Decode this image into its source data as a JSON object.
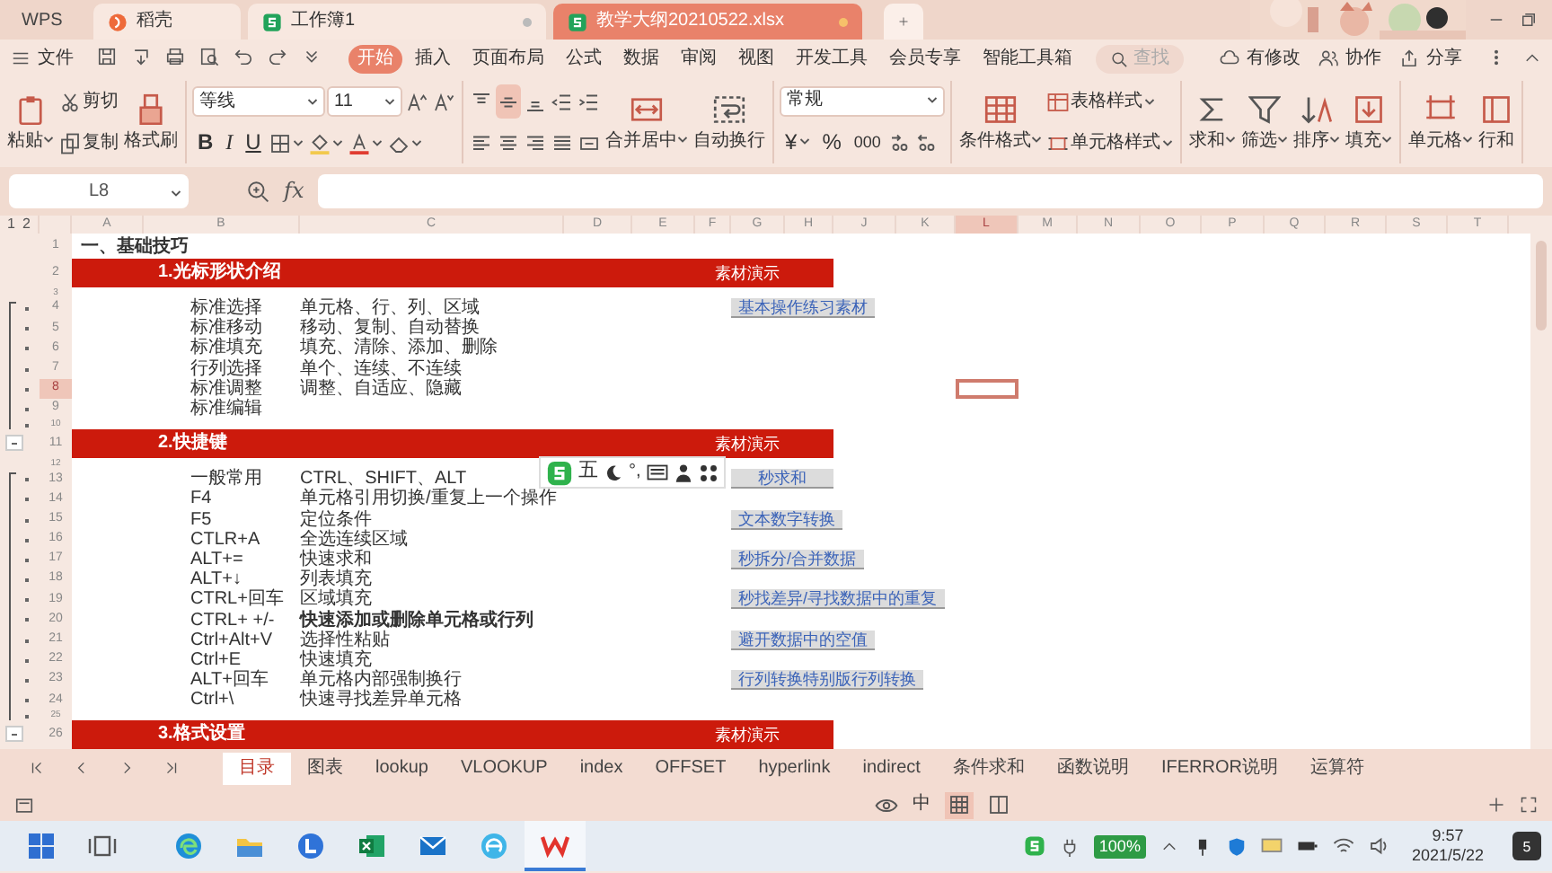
{
  "title_tabs": [
    {
      "label": "WPS",
      "kind": "home",
      "selected": false
    },
    {
      "label": "稻壳",
      "kind": "docer",
      "selected": false
    },
    {
      "label": "工作簿1",
      "kind": "sheet",
      "selected": false
    },
    {
      "label": "教学大纲20210522.xlsx",
      "kind": "sheet",
      "selected": true
    }
  ],
  "menu": {
    "file": "文件",
    "tabs": [
      {
        "label": "开始",
        "selected": true
      },
      {
        "label": "插入",
        "selected": false
      },
      {
        "label": "页面布局",
        "selected": false
      },
      {
        "label": "公式",
        "selected": false
      },
      {
        "label": "数据",
        "selected": false
      },
      {
        "label": "审阅",
        "selected": false
      },
      {
        "label": "视图",
        "selected": false
      },
      {
        "label": "开发工具",
        "selected": false
      },
      {
        "label": "会员专享",
        "selected": false
      },
      {
        "label": "智能工具箱",
        "selected": false
      }
    ],
    "search": {
      "placeholder": "查找"
    },
    "actions": [
      {
        "label": "有修改",
        "kind": "cloud"
      },
      {
        "label": "协作",
        "kind": "people"
      },
      {
        "label": "分享",
        "kind": "share"
      }
    ]
  },
  "ribbon": [
    {
      "controls": [
        {
          "kind": "paste",
          "label": "粘贴",
          "dropdown": true
        },
        {
          "kind": "stack",
          "lines": [
            [
              {
                "kind": "cut",
                "label": "剪切"
              }
            ],
            [
              {
                "kind": "copy",
                "label": "复制"
              }
            ]
          ]
        },
        {
          "kind": "brush",
          "label": "格式刷"
        }
      ]
    },
    {
      "controls": [
        {
          "kind": "stack",
          "lines": [
            [
              {
                "kind": "font",
                "value": "等线"
              },
              {
                "kind": "size",
                "value": "11"
              },
              {
                "kind": "grow"
              },
              {
                "kind": "shrink"
              }
            ],
            [
              {
                "kind": "bold",
                "label": "B"
              },
              {
                "kind": "italic",
                "label": "I"
              },
              {
                "kind": "underline",
                "label": "U"
              },
              {
                "kind": "border",
                "dropdown": true
              },
              {
                "kind": "fill",
                "dropdown": true
              },
              {
                "kind": "fontcolor",
                "dropdown": true
              },
              {
                "kind": "eraser",
                "dropdown": true
              }
            ]
          ]
        }
      ]
    },
    {
      "controls": [
        {
          "kind": "stack",
          "lines": [
            [
              {
                "kind": "vtop",
                "selected": false
              },
              {
                "kind": "vmid",
                "selected": true
              },
              {
                "kind": "vbot",
                "selected": false
              },
              {
                "kind": "indl",
                "selected": false
              },
              {
                "kind": "indr",
                "selected": false
              }
            ],
            [
              {
                "kind": "left",
                "selected": false
              },
              {
                "kind": "center",
                "selected": false
              },
              {
                "kind": "right",
                "selected": false
              },
              {
                "kind": "justify",
                "selected": false
              },
              {
                "kind": "distribute",
                "selected": false
              }
            ]
          ]
        },
        {
          "kind": "merge",
          "label": "合并居中",
          "dropdown": true
        },
        {
          "kind": "wrap",
          "label": "自动换行"
        }
      ]
    },
    {
      "controls": [
        {
          "kind": "stack",
          "lines": [
            [
              {
                "kind": "format",
                "value": "常规"
              }
            ],
            [
              {
                "kind": "currency",
                "label": "¥",
                "dropdown": true
              },
              {
                "kind": "percent",
                "label": "%"
              },
              {
                "kind": "thousands",
                "label": "000"
              },
              {
                "kind": "decinc"
              },
              {
                "kind": "decdec"
              }
            ]
          ]
        }
      ]
    },
    {
      "controls": [
        {
          "kind": "cond",
          "label": "条件格式",
          "dropdown": true
        },
        {
          "kind": "stack",
          "lines": [
            [
              {
                "kind": "tablestyle",
                "label": "表格样式",
                "dropdown": true
              }
            ],
            [
              {
                "kind": "cellstyle",
                "label": "单元格样式",
                "dropdown": true
              }
            ]
          ]
        }
      ]
    },
    {
      "controls": [
        {
          "kind": "sum",
          "label": "求和",
          "dropdown": true
        },
        {
          "kind": "filter",
          "label": "筛选",
          "dropdown": true
        },
        {
          "kind": "sort",
          "label": "排序",
          "dropdown": true
        },
        {
          "kind": "fillcmd",
          "label": "填充",
          "dropdown": true
        }
      ]
    },
    {
      "controls": [
        {
          "kind": "cell",
          "label": "单元格",
          "dropdown": true
        },
        {
          "kind": "rowcol",
          "label": "行和"
        }
      ]
    }
  ],
  "formula_bar": {
    "name_box": "L8",
    "fx": "fx"
  },
  "sheet": {
    "outline_levels": [
      "1",
      "2"
    ],
    "columns": [
      {
        "label": "A",
        "selected": false
      },
      {
        "label": "B",
        "selected": false
      },
      {
        "label": "C",
        "selected": false
      },
      {
        "label": "D",
        "selected": false
      },
      {
        "label": "E",
        "selected": false
      },
      {
        "label": "F",
        "selected": false
      },
      {
        "label": "G",
        "selected": false
      },
      {
        "label": "H",
        "selected": false
      },
      {
        "label": "J",
        "selected": false
      },
      {
        "label": "K",
        "selected": false
      },
      {
        "label": "L",
        "selected": true
      },
      {
        "label": "M",
        "selected": false
      },
      {
        "label": "N",
        "selected": false
      },
      {
        "label": "O",
        "selected": false
      },
      {
        "label": "P",
        "selected": false
      },
      {
        "label": "Q",
        "selected": false
      },
      {
        "label": "R",
        "selected": false
      },
      {
        "label": "S",
        "selected": false
      },
      {
        "label": "T",
        "selected": false
      }
    ],
    "rows": [
      {
        "num": "1",
        "kind": "title",
        "a": "一、基础技巧",
        "grouped": false,
        "toggle": false,
        "selected": false
      },
      {
        "num": "2",
        "kind": "section",
        "b": "1.光标形状介绍",
        "g": "素材演示",
        "grouped": false,
        "toggle": false,
        "selected": false
      },
      {
        "num": "3",
        "kind": "thin",
        "grouped": false,
        "toggle": false,
        "selected": false
      },
      {
        "num": "4",
        "kind": "item",
        "b": "标准选择",
        "c": "单元格、行、列、区域",
        "link": "基本操作练习素材",
        "grouped": true,
        "toggle": false,
        "selected": false
      },
      {
        "num": "5",
        "kind": "item",
        "b": "标准移动",
        "c": "移动、复制、自动替换",
        "grouped": true,
        "toggle": false,
        "selected": false
      },
      {
        "num": "6",
        "kind": "item",
        "b": "标准填充",
        "c": "填充、清除、添加、删除",
        "grouped": true,
        "toggle": false,
        "selected": false
      },
      {
        "num": "7",
        "kind": "item",
        "b": "行列选择",
        "c": "单个、连续、不连续",
        "grouped": true,
        "toggle": false,
        "selected": false
      },
      {
        "num": "8",
        "kind": "item",
        "b": "标准调整",
        "c": "调整、自适应、隐藏",
        "grouped": true,
        "toggle": false,
        "selected": true
      },
      {
        "num": "9",
        "kind": "item",
        "b": "标准编辑",
        "grouped": true,
        "toggle": false,
        "selected": false
      },
      {
        "num": "10",
        "kind": "thin",
        "grouped": true,
        "toggle": false,
        "selected": false
      },
      {
        "num": "11",
        "kind": "section",
        "b": "2.快捷键",
        "g": "素材演示",
        "grouped": false,
        "toggle": true,
        "selected": false
      },
      {
        "num": "12",
        "kind": "thin",
        "grouped": false,
        "toggle": false,
        "selected": false
      },
      {
        "num": "13",
        "kind": "item",
        "b": "一般常用",
        "c": "CTRL、SHIFT、ALT",
        "link": "秒求和",
        "grouped": true,
        "toggle": false,
        "selected": false
      },
      {
        "num": "14",
        "kind": "item",
        "b": "F4",
        "c": "单元格引用切换/重复上一个操作",
        "grouped": true,
        "toggle": false,
        "selected": false
      },
      {
        "num": "15",
        "kind": "item",
        "b": "F5",
        "c": "定位条件",
        "link": "文本数字转换",
        "grouped": true,
        "toggle": false,
        "selected": false
      },
      {
        "num": "16",
        "kind": "item",
        "b": "CTLR+A",
        "c": "全选连续区域",
        "grouped": true,
        "toggle": false,
        "selected": false
      },
      {
        "num": "17",
        "kind": "item",
        "b": "ALT+=",
        "c": "快速求和",
        "link": "秒拆分/合并数据",
        "grouped": true,
        "toggle": false,
        "selected": false
      },
      {
        "num": "18",
        "kind": "item",
        "b": "ALT+↓",
        "c": "列表填充",
        "grouped": true,
        "toggle": false,
        "selected": false
      },
      {
        "num": "19",
        "kind": "item",
        "b": "CTRL+回车",
        "c": "区域填充",
        "link": "秒找差异/寻找数据中的重复",
        "grouped": true,
        "toggle": false,
        "selected": false
      },
      {
        "num": "20",
        "kind": "item",
        "b": "CTRL+ +/-",
        "c": "快速添加或删除单元格或行列",
        "bold": true,
        "grouped": true,
        "toggle": false,
        "selected": false
      },
      {
        "num": "21",
        "kind": "item",
        "b": "Ctrl+Alt+V",
        "c": "选择性粘贴",
        "link": "避开数据中的空值",
        "grouped": true,
        "toggle": false,
        "selected": false
      },
      {
        "num": "22",
        "kind": "item",
        "b": "Ctrl+E",
        "c": "快速填充",
        "grouped": true,
        "toggle": false,
        "selected": false
      },
      {
        "num": "23",
        "kind": "item",
        "b": "ALT+回车",
        "c": "单元格内部强制换行",
        "link": "行列转换特别版行列转换",
        "grouped": true,
        "toggle": false,
        "selected": false
      },
      {
        "num": "24",
        "kind": "item",
        "b": "Ctrl+\\",
        "c": "快速寻找差异单元格",
        "grouped": true,
        "toggle": false,
        "selected": false
      },
      {
        "num": "25",
        "kind": "thin",
        "grouped": true,
        "toggle": false,
        "selected": false
      },
      {
        "num": "26",
        "kind": "section",
        "b": "3.格式设置",
        "g": "素材演示",
        "grouped": false,
        "toggle": true,
        "selected": false
      }
    ]
  },
  "ime_toolbar": {
    "mode": "五",
    "punctuation": "°,"
  },
  "sheet_tabs": [
    {
      "label": "目录",
      "selected": true
    },
    {
      "label": "图表",
      "selected": false
    },
    {
      "label": "lookup",
      "selected": false
    },
    {
      "label": "VLOOKUP",
      "selected": false
    },
    {
      "label": "index",
      "selected": false
    },
    {
      "label": "OFFSET",
      "selected": false
    },
    {
      "label": "hyperlink",
      "selected": false
    },
    {
      "label": "indirect",
      "selected": false
    },
    {
      "label": "条件求和",
      "selected": false
    },
    {
      "label": "函数说明",
      "selected": false
    },
    {
      "label": "IFERROR说明",
      "selected": false
    },
    {
      "label": "运算符",
      "selected": false
    }
  ],
  "status_bar": {
    "input_mode": "中"
  },
  "taskbar": {
    "apps": [
      {
        "kind": "start",
        "selected": false
      },
      {
        "kind": "taskview",
        "selected": false
      },
      {
        "kind": "edge",
        "selected": false
      },
      {
        "kind": "explorer",
        "selected": false
      },
      {
        "kind": "lark",
        "selected": false
      },
      {
        "kind": "excel",
        "selected": false
      },
      {
        "kind": "mail",
        "selected": false
      },
      {
        "kind": "browser",
        "selected": false
      },
      {
        "kind": "wps",
        "selected": true
      }
    ],
    "battery": "100%",
    "time": "9:57",
    "date": "2021/5/22",
    "notifications": "5"
  }
}
